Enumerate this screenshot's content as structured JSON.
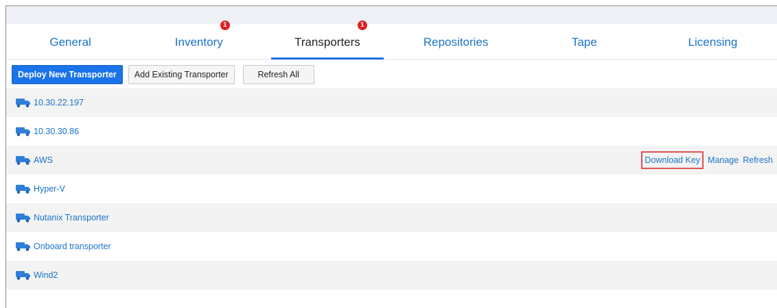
{
  "tabs": [
    {
      "label": "General",
      "badge": null
    },
    {
      "label": "Inventory",
      "badge": "1"
    },
    {
      "label": "Transporters",
      "badge": "1",
      "active": true
    },
    {
      "label": "Repositories",
      "badge": null
    },
    {
      "label": "Tape",
      "badge": null
    },
    {
      "label": "Licensing",
      "badge": null
    }
  ],
  "toolbar": {
    "deploy_label": "Deploy New Transporter",
    "add_label": "Add Existing Transporter",
    "refresh_all_label": "Refresh All"
  },
  "transporters": [
    {
      "name": "10.30.22.197",
      "icon": "truck-icon"
    },
    {
      "name": "10.30.30.86",
      "icon": "truck-icon"
    },
    {
      "name": "AWS",
      "icon": "truck-icon"
    },
    {
      "name": "Hyper-V",
      "icon": "truck-icon"
    },
    {
      "name": "Nutanix Transporter",
      "icon": "truck-icon"
    },
    {
      "name": "Onboard transporter",
      "icon": "truck-icon"
    },
    {
      "name": "Wind2",
      "icon": "truck-icon"
    }
  ],
  "row_actions": {
    "download_key": "Download Key",
    "manage": "Manage",
    "refresh": "Refresh"
  },
  "colors": {
    "accent": "#1a73e8",
    "link": "#1a73c8",
    "badge": "#e02020",
    "highlight_border": "#e05050",
    "row_alt": "#f3f3f3"
  }
}
